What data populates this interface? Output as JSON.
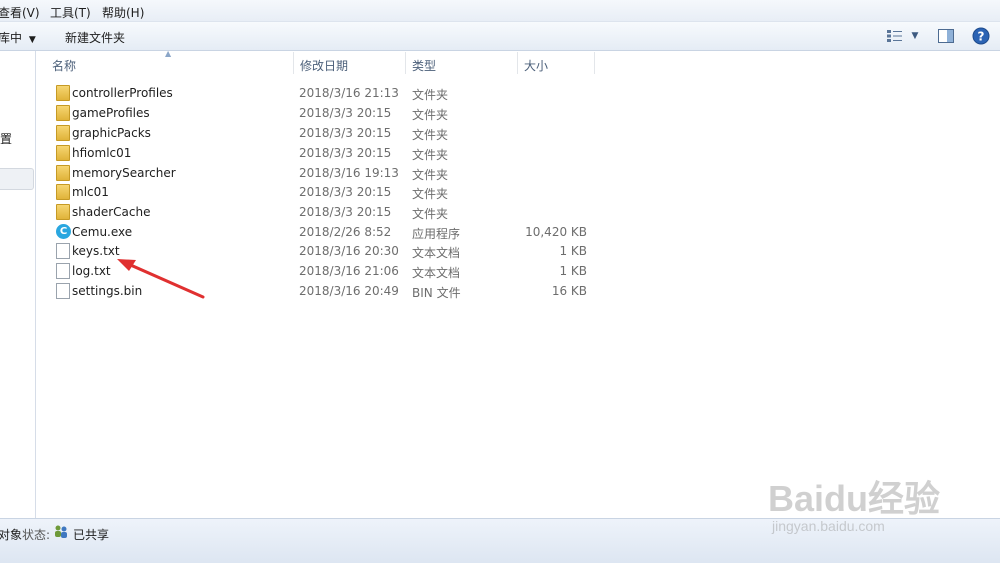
{
  "menu": [
    {
      "label": "查看(V)"
    },
    {
      "label": "工具(T)"
    },
    {
      "label": "帮助(H)"
    }
  ],
  "toolbar": {
    "library_label": "库中",
    "new_folder_label": "新建文件夹"
  },
  "nav": {
    "partial_label": "置"
  },
  "columns": {
    "name": "名称",
    "date": "修改日期",
    "type": "类型",
    "size": "大小"
  },
  "files": [
    {
      "name": "controllerProfiles",
      "date": "2018/3/16 21:13",
      "type": "文件夹",
      "size": "",
      "icon": "folder-icon"
    },
    {
      "name": "gameProfiles",
      "date": "2018/3/3 20:15",
      "type": "文件夹",
      "size": "",
      "icon": "folder-icon"
    },
    {
      "name": "graphicPacks",
      "date": "2018/3/3 20:15",
      "type": "文件夹",
      "size": "",
      "icon": "folder-icon"
    },
    {
      "name": "hfiomlc01",
      "date": "2018/3/3 20:15",
      "type": "文件夹",
      "size": "",
      "icon": "folder-icon"
    },
    {
      "name": "memorySearcher",
      "date": "2018/3/16 19:13",
      "type": "文件夹",
      "size": "",
      "icon": "folder-icon"
    },
    {
      "name": "mlc01",
      "date": "2018/3/3 20:15",
      "type": "文件夹",
      "size": "",
      "icon": "folder-icon"
    },
    {
      "name": "shaderCache",
      "date": "2018/3/3 20:15",
      "type": "文件夹",
      "size": "",
      "icon": "folder-icon"
    },
    {
      "name": "Cemu.exe",
      "date": "2018/2/26 8:52",
      "type": "应用程序",
      "size": "10,420 KB",
      "icon": "cemu-app-icon"
    },
    {
      "name": "keys.txt",
      "date": "2018/3/16 20:30",
      "type": "文本文档",
      "size": "1 KB",
      "icon": "text-file-icon"
    },
    {
      "name": "log.txt",
      "date": "2018/3/16 21:06",
      "type": "文本文档",
      "size": "1 KB",
      "icon": "text-file-icon"
    },
    {
      "name": "settings.bin",
      "date": "2018/3/16 20:49",
      "type": "BIN 文件",
      "size": "16 KB",
      "icon": "file-icon"
    }
  ],
  "status": {
    "objects_partial": "对象",
    "state_label": "状态:",
    "shared_label": "已共享"
  },
  "watermark": {
    "brand": "Baidu经验",
    "url": "jingyan.baidu.com"
  },
  "colors": {
    "annotation_arrow": "#e03030",
    "folder": "#e8c04a",
    "cemu": "#2aa7e0"
  }
}
